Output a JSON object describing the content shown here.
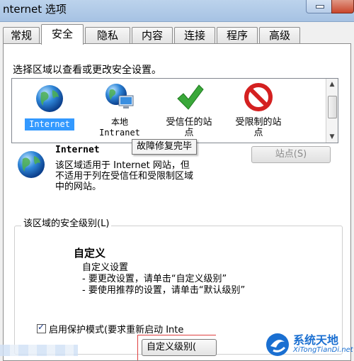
{
  "window": {
    "title": "nternet 选项"
  },
  "tabs": [
    {
      "label": "常规"
    },
    {
      "label": "安全",
      "active": true
    },
    {
      "label": "隐私"
    },
    {
      "label": "内容"
    },
    {
      "label": "连接"
    },
    {
      "label": "程序"
    },
    {
      "label": "高级"
    }
  ],
  "security": {
    "instruction": "选择区域以查看或更改安全设置。",
    "zones": [
      {
        "label": "Internet",
        "icon": "globe-icon",
        "selected": true
      },
      {
        "label_line1": "本地",
        "label_line2": "Intranet",
        "icon": "local-intranet-icon"
      },
      {
        "label_line1": "受信任的站",
        "label_line2": "点",
        "icon": "green-check-icon"
      },
      {
        "label_line1": "受限制的站",
        "label_line2": "点",
        "icon": "no-entry-icon"
      }
    ],
    "tooltip": "故障修复完毕",
    "zone_title": "Internet",
    "zone_desc_line1": "该区域适用于 Internet 网站，但",
    "zone_desc_line2": "不适用于列在受信任和受限制区域",
    "zone_desc_line3": "中的网站。",
    "sites_button": "站点(S)",
    "level_group_label": "该区域的安全级别(L)",
    "custom_title": "自定义",
    "custom_desc_line1": "自定义设置",
    "custom_desc_line2": "- 要更改设置，请单击“自定义级别”",
    "custom_desc_line3": "- 要使用推荐的设置，请单击“默认级别”",
    "protected_mode": "启用保护模式(要求重新启动 Inte",
    "protected_checked": true,
    "custom_level_button": "自定义级别("
  },
  "watermark": {
    "name": "系统天地",
    "url": "XiTongTianDi.net"
  },
  "colors": {
    "selection": "#3399ff",
    "check_green": "#3aa83a",
    "no_red": "#d42020",
    "watermark_blue": "#1a6fd1"
  }
}
